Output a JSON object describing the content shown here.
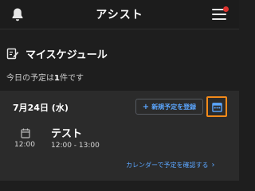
{
  "header": {
    "title": "アシスト",
    "bell_icon": "bell-icon",
    "menu_icon": "hamburger-menu-icon",
    "notification_color": "#e0332f"
  },
  "section": {
    "icon": "edit-note-icon",
    "title": "マイスケジュール"
  },
  "summary": {
    "prefix": "今日の予定は",
    "count": "1",
    "suffix": "件です"
  },
  "schedule": {
    "date": "7月24日 (水)",
    "add_button_icon": "plus-icon",
    "add_button_label": "新規予定を登録",
    "calendar_button_icon": "calendar-icon",
    "highlight_color": "#f28a1a",
    "events": [
      {
        "icon": "calendar-small-icon",
        "start_time": "12:00",
        "title": "テスト",
        "time_range": "12:00 - 13:00"
      }
    ],
    "link_label": "カレンダーで予定を確認する",
    "link_icon": "chevron-right-icon"
  },
  "colors": {
    "background": "#1e1e1e",
    "card": "#2b2b2b",
    "accent": "#5ba6ff"
  }
}
